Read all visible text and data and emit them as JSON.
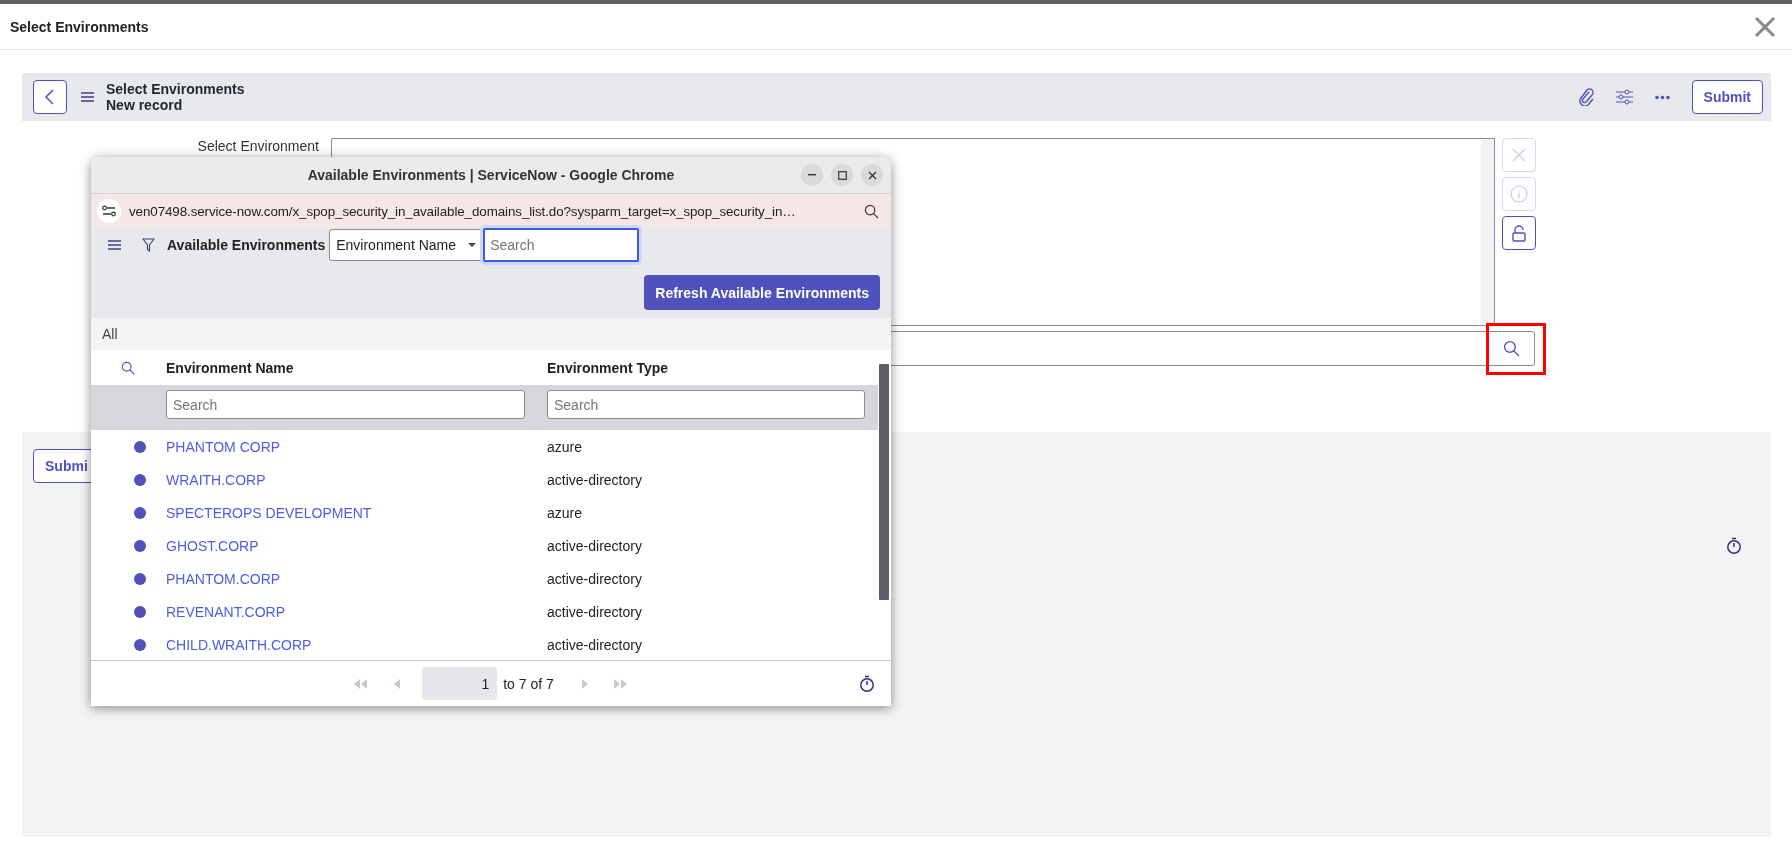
{
  "dialog": {
    "title": "Select Environments"
  },
  "form_header": {
    "title": "Select Environments",
    "subtitle": "New record",
    "submit_label": "Submit"
  },
  "form": {
    "field_label": "Select Environment",
    "side_buttons": [
      {
        "kind": "clear",
        "disabled": true
      },
      {
        "kind": "info",
        "disabled": true
      },
      {
        "kind": "lock",
        "disabled": false
      }
    ],
    "lookup_highlighted": true
  },
  "lower_panel": {
    "submit_label": "Submi"
  },
  "popup": {
    "title": "Available Environments | ServiceNow - Google Chrome",
    "url": "ven07498.service-now.com/x_spop_security_in_available_domains_list.do?sysparm_target=x_spop_security_in…",
    "list_title": "Available Environments",
    "search_field_select": "Environment Name",
    "search_placeholder": "Search",
    "refresh_button": "Refresh Available Environments",
    "breadcrumb": "All",
    "columns": [
      {
        "label": "Environment Name",
        "filter_placeholder": "Search"
      },
      {
        "label": "Environment Type",
        "filter_placeholder": "Search"
      }
    ],
    "rows": [
      {
        "name": "PHANTOM CORP",
        "type": "azure"
      },
      {
        "name": "WRAITH.CORP",
        "type": "active-directory"
      },
      {
        "name": "SPECTEROPS DEVELOPMENT",
        "type": "azure"
      },
      {
        "name": "GHOST.CORP",
        "type": "active-directory"
      },
      {
        "name": "PHANTOM.CORP",
        "type": "active-directory"
      },
      {
        "name": "REVENANT.CORP",
        "type": "active-directory"
      },
      {
        "name": "CHILD.WRAITH.CORP",
        "type": "active-directory"
      }
    ],
    "pagination": {
      "page": "1",
      "range": "to 7 of 7"
    }
  }
}
